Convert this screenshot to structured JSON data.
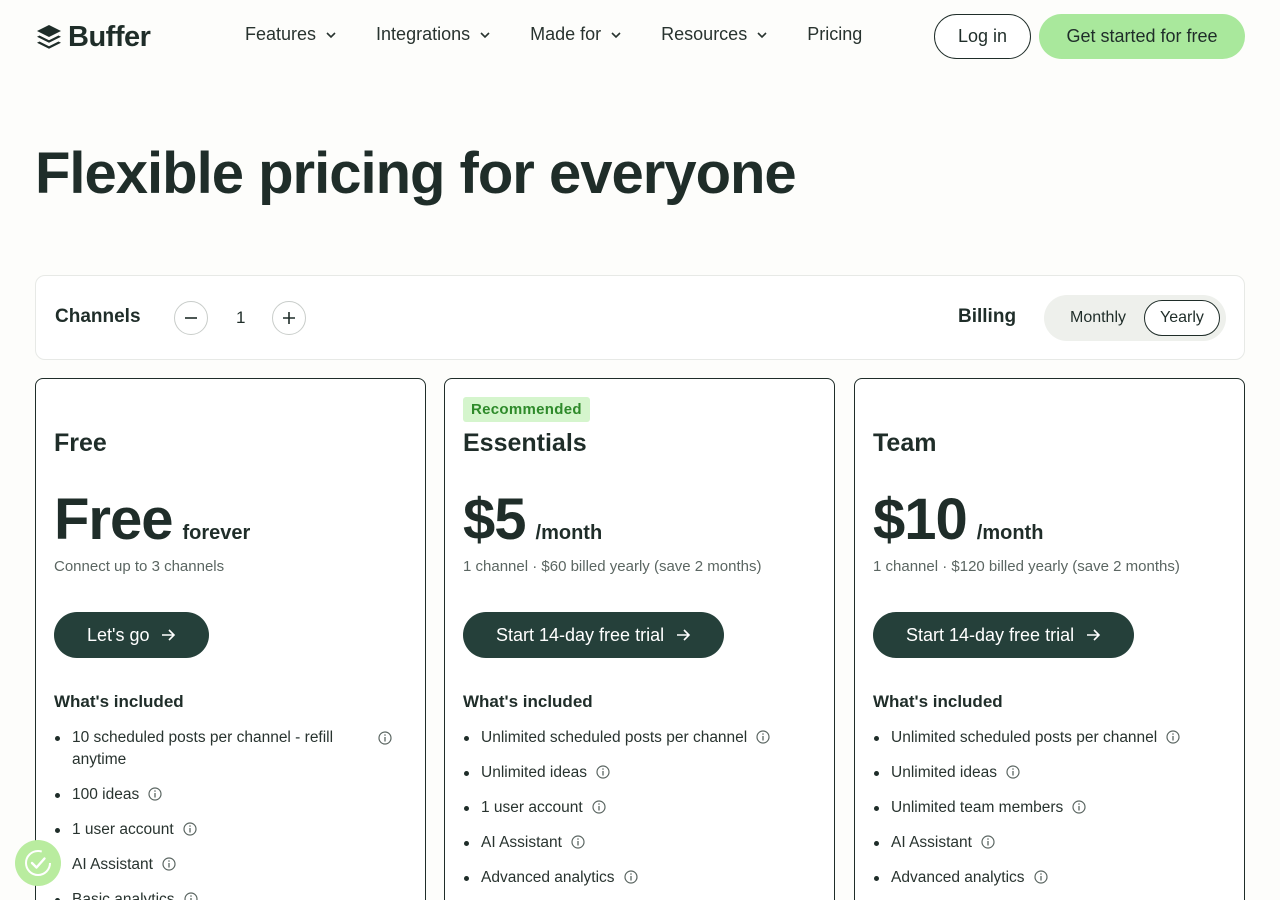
{
  "brand": {
    "name": "Buffer"
  },
  "nav": {
    "items": [
      {
        "label": "Features",
        "dropdown": true
      },
      {
        "label": "Integrations",
        "dropdown": true
      },
      {
        "label": "Made for",
        "dropdown": true
      },
      {
        "label": "Resources",
        "dropdown": true
      },
      {
        "label": "Pricing",
        "dropdown": false
      }
    ],
    "login_label": "Log in",
    "cta_label": "Get started for free"
  },
  "hero": {
    "title": "Flexible pricing for everyone"
  },
  "controls": {
    "channels_label": "Channels",
    "channels_count": "1",
    "billing_label": "Billing",
    "billing_options": [
      "Monthly",
      "Yearly"
    ],
    "billing_selected": "Yearly"
  },
  "plans": [
    {
      "name": "Free",
      "price": "Free",
      "price_suffix": "forever",
      "subtext": "Connect up to 3 channels",
      "button_label": "Let's go",
      "included_label": "What's included",
      "features": [
        "10 scheduled posts per channel - refill anytime",
        "100 ideas",
        "1 user account",
        "AI Assistant",
        "Basic analytics"
      ]
    },
    {
      "badge": "Recommended",
      "name": "Essentials",
      "price": "$5",
      "price_suffix": "/month",
      "subtext": "1 channel · $60 billed yearly (save 2 months)",
      "button_label": "Start 14-day free trial",
      "included_label": "What's included",
      "features": [
        "Unlimited scheduled posts per channel",
        "Unlimited ideas",
        "1 user account",
        "AI Assistant",
        "Advanced analytics"
      ]
    },
    {
      "name": "Team",
      "price": "$10",
      "price_suffix": "/month",
      "subtext": "1 channel · $120 billed yearly (save 2 months)",
      "button_label": "Start 14-day free trial",
      "included_label": "What's included",
      "features": [
        "Unlimited scheduled posts per channel",
        "Unlimited ideas",
        "Unlimited team members",
        "AI Assistant",
        "Advanced analytics"
      ]
    }
  ],
  "colors": {
    "dark": "#1f2d29",
    "button_dark": "#25403a",
    "accent_green": "#a9e89c",
    "badge_bg": "#d5f5cd",
    "badge_text": "#2e8a2a"
  },
  "icons": {
    "logo": "layers-stack-icon",
    "dropdown": "chevron-down-icon",
    "arrow": "arrow-right-icon",
    "info": "info-icon",
    "minus": "minus-icon",
    "plus": "plus-icon",
    "widget": "accessibility-check-icon"
  }
}
